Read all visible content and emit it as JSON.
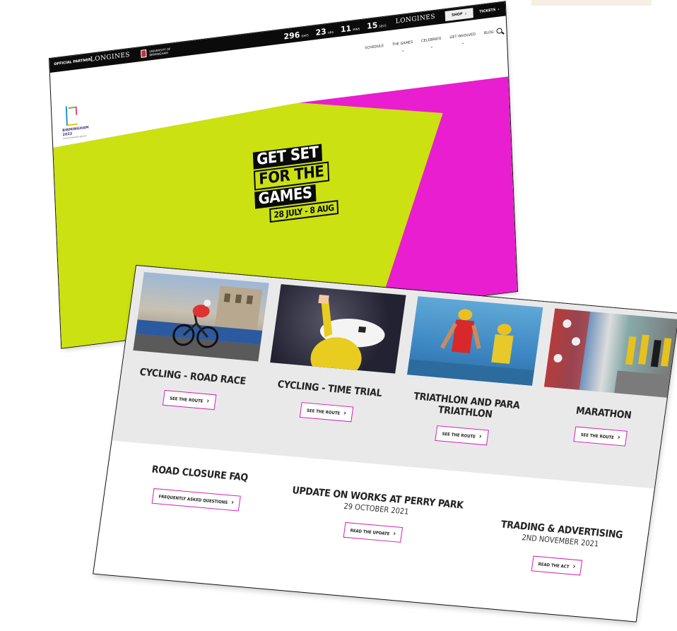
{
  "homepage": {
    "topbar": {
      "official_partner": "OFFICIAL PARTNER",
      "partner_logo": "LONGINES",
      "university_name": "UNIVERSITY OF BIRMINGHAM",
      "countdown": [
        {
          "value": "296",
          "unit": "DAYS"
        },
        {
          "value": "23",
          "unit": "HRS"
        },
        {
          "value": "11",
          "unit": "MINS"
        },
        {
          "value": "15",
          "unit": "SECS"
        }
      ],
      "right_logo": "LONGINES",
      "shop_label": "SHOP",
      "tickets_label": "TICKETS"
    },
    "nav": [
      "SCHEDULE",
      "THE GAMES",
      "CELEBRATE",
      "GET INVOLVED",
      "BLOG"
    ],
    "logo": {
      "text": "BIRMINGHAM 2022",
      "subtext": "commonwealth games"
    },
    "hero": {
      "lines": [
        "GET SET",
        "FOR THE",
        "GAMES"
      ],
      "dates": "28 JULY - 8 AUG",
      "colors": {
        "lime": "#cbe111",
        "magenta": "#e81ed0"
      }
    }
  },
  "routes_page": {
    "cards": [
      {
        "title": "CYCLING - ROAD RACE",
        "button": "SEE THE ROUTE"
      },
      {
        "title": "CYCLING - TIME TRIAL",
        "button": "SEE THE ROUTE"
      },
      {
        "title": "TRIATHLON AND PARA TRIATHLON",
        "button": "SEE THE ROUTE"
      },
      {
        "title": "MARATHON",
        "button": "SEE THE ROUTE"
      }
    ],
    "info": [
      {
        "title": "ROAD CLOSURE FAQ",
        "date": "",
        "button": "FREQUENTLY ASKED QUESTIONS"
      },
      {
        "title": "UPDATE ON WORKS AT PERRY PARK",
        "date": "29 OCTOBER 2021",
        "button": "READ THE UPDATE"
      },
      {
        "title": "TRADING & ADVERTISING",
        "date": "2ND NOVEMBER 2021",
        "button": "READ THE ACT"
      }
    ],
    "accent_color": "#d21fb0"
  }
}
